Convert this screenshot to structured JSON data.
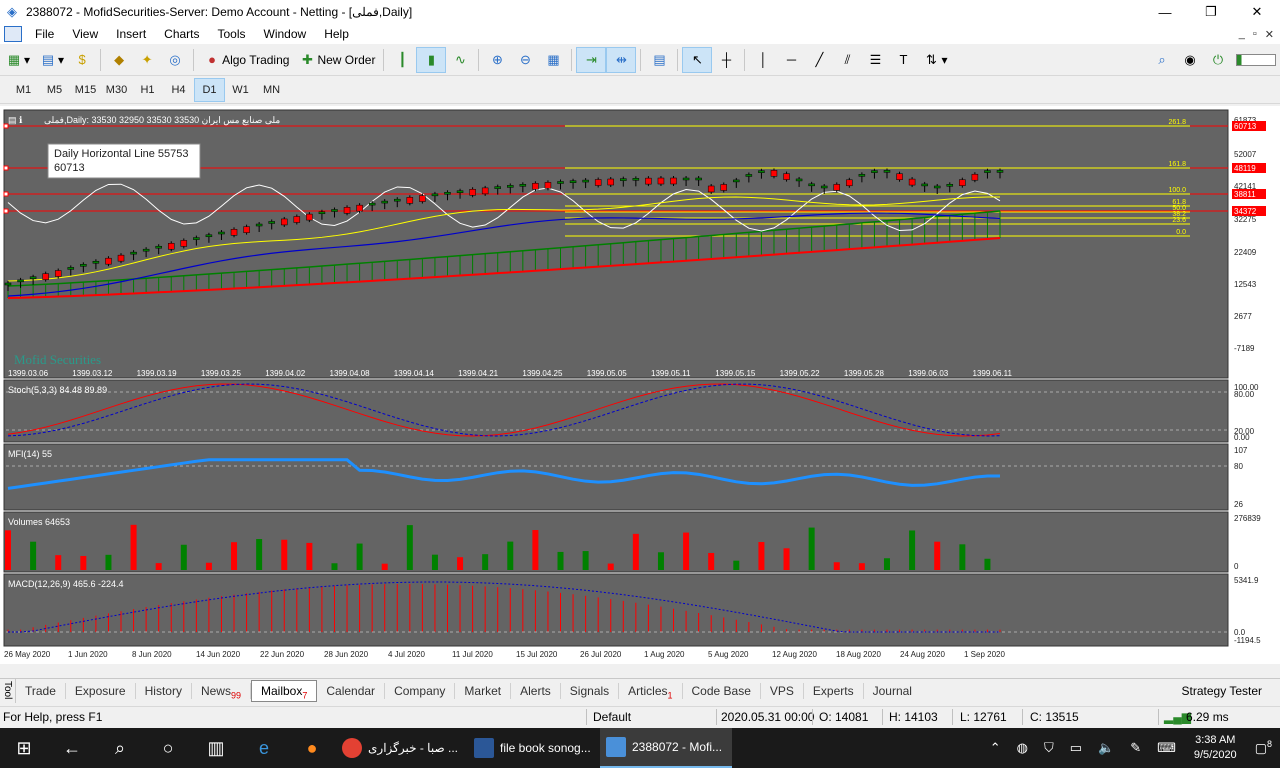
{
  "window": {
    "title": "2388072 - MofidSecurities-Server: Demo Account - Netting - [فملی,Daily]",
    "minimize": "—",
    "maximize": "❐",
    "close": "✕"
  },
  "menu": [
    "File",
    "View",
    "Insert",
    "Charts",
    "Tools",
    "Window",
    "Help"
  ],
  "mdi_controls": [
    "_",
    "▫",
    "✕"
  ],
  "toolbar": {
    "algo_trading": "Algo Trading",
    "new_order": "New Order"
  },
  "timeframes": [
    "M1",
    "M5",
    "M15",
    "M30",
    "H1",
    "H4",
    "D1",
    "W1",
    "MN"
  ],
  "active_timeframe": "D1",
  "chart": {
    "header": "فملی,Daily:  33530 32950 33530 33530  ملی صنایع مس ایران",
    "tooltip_line1": "Daily Horizontal Line 55753",
    "tooltip_line2": "60713",
    "watermark": "Mofid Securities",
    "price_axis": [
      "61873",
      "52007",
      "42141",
      "32275",
      "22409",
      "12543",
      "2677",
      "-7189"
    ],
    "price_tags": [
      "60713",
      "48119",
      "38811",
      "34372"
    ],
    "fib_labels": [
      "261.8",
      "161.8",
      "100.0",
      "61.8",
      "50.0",
      "38.2",
      "23.6",
      "0.0"
    ],
    "shamsi_dates": [
      "1399.03.06",
      "1399.03.12",
      "1399.03.19",
      "1399.03.25",
      "1399.04.02",
      "1399.04.08",
      "1399.04.14",
      "1399.04.21",
      "1399.04.25",
      "1399.05.05",
      "1399.05.11",
      "1399.05.15",
      "1399.05.22",
      "1399.05.28",
      "1399.06.03",
      "1399.06.11"
    ],
    "stoch_label": "Stoch(5,3,3) 84.48 89.89",
    "stoch_axis": [
      "100.00",
      "80.00",
      "20.00",
      "0.00"
    ],
    "mfi_label": "MFI(14) 55",
    "mfi_axis": [
      "107",
      "80",
      "26"
    ],
    "volumes_label": "Volumes 64653",
    "volumes_axis": [
      "276839",
      "0"
    ],
    "macd_label": "MACD(12,26,9) 465.6 -224.4",
    "macd_axis": [
      "5341.9",
      "0.0",
      "-1194.5"
    ],
    "gregorian_dates": [
      "26 May 2020",
      "1 Jun 2020",
      "8 Jun 2020",
      "14 Jun 2020",
      "22 Jun 2020",
      "28 Jun 2020",
      "4 Jul 2020",
      "11 Jul 2020",
      "15 Jul 2020",
      "26 Jul 2020",
      "1 Aug 2020",
      "5 Aug 2020",
      "12 Aug 2020",
      "18 Aug 2020",
      "24 Aug 2020",
      "1 Sep 2020"
    ]
  },
  "tabs": [
    {
      "label": "Trade",
      "badge": ""
    },
    {
      "label": "Exposure",
      "badge": ""
    },
    {
      "label": "History",
      "badge": ""
    },
    {
      "label": "News",
      "badge": "99"
    },
    {
      "label": "Mailbox",
      "badge": "7"
    },
    {
      "label": "Calendar",
      "badge": ""
    },
    {
      "label": "Company",
      "badge": ""
    },
    {
      "label": "Market",
      "badge": ""
    },
    {
      "label": "Alerts",
      "badge": ""
    },
    {
      "label": "Signals",
      "badge": ""
    },
    {
      "label": "Articles",
      "badge": "1"
    },
    {
      "label": "Code Base",
      "badge": ""
    },
    {
      "label": "VPS",
      "badge": ""
    },
    {
      "label": "Experts",
      "badge": ""
    },
    {
      "label": "Journal",
      "badge": ""
    }
  ],
  "active_tab": "Mailbox",
  "toolbox_label": "Tool",
  "strategy_tester": "Strategy Tester",
  "status": {
    "help": "For Help, press F1",
    "profile": "Default",
    "datetime": "2020.05.31 00:00",
    "open": "O: 14081",
    "high": "H: 14103",
    "low": "L: 12761",
    "close": "C: 13515",
    "ping": "6.29 ms"
  },
  "taskbar": {
    "apps": [
      {
        "label": "صبا - خبرگزاری ...",
        "color": "#e34133"
      },
      {
        "label": "file book sonog...",
        "color": "#2b5797"
      },
      {
        "label": "2388072 - Mofi...",
        "color": "#4a90d9"
      }
    ],
    "time": "3:38 AM",
    "date": "9/5/2020",
    "notif": "8"
  },
  "colors": {
    "chart_bg": "#646464",
    "bull": "#008000",
    "bear": "#ff0000",
    "fib": "#ffff00",
    "ma_blue": "#0000cd",
    "mfi": "#1e90ff"
  }
}
